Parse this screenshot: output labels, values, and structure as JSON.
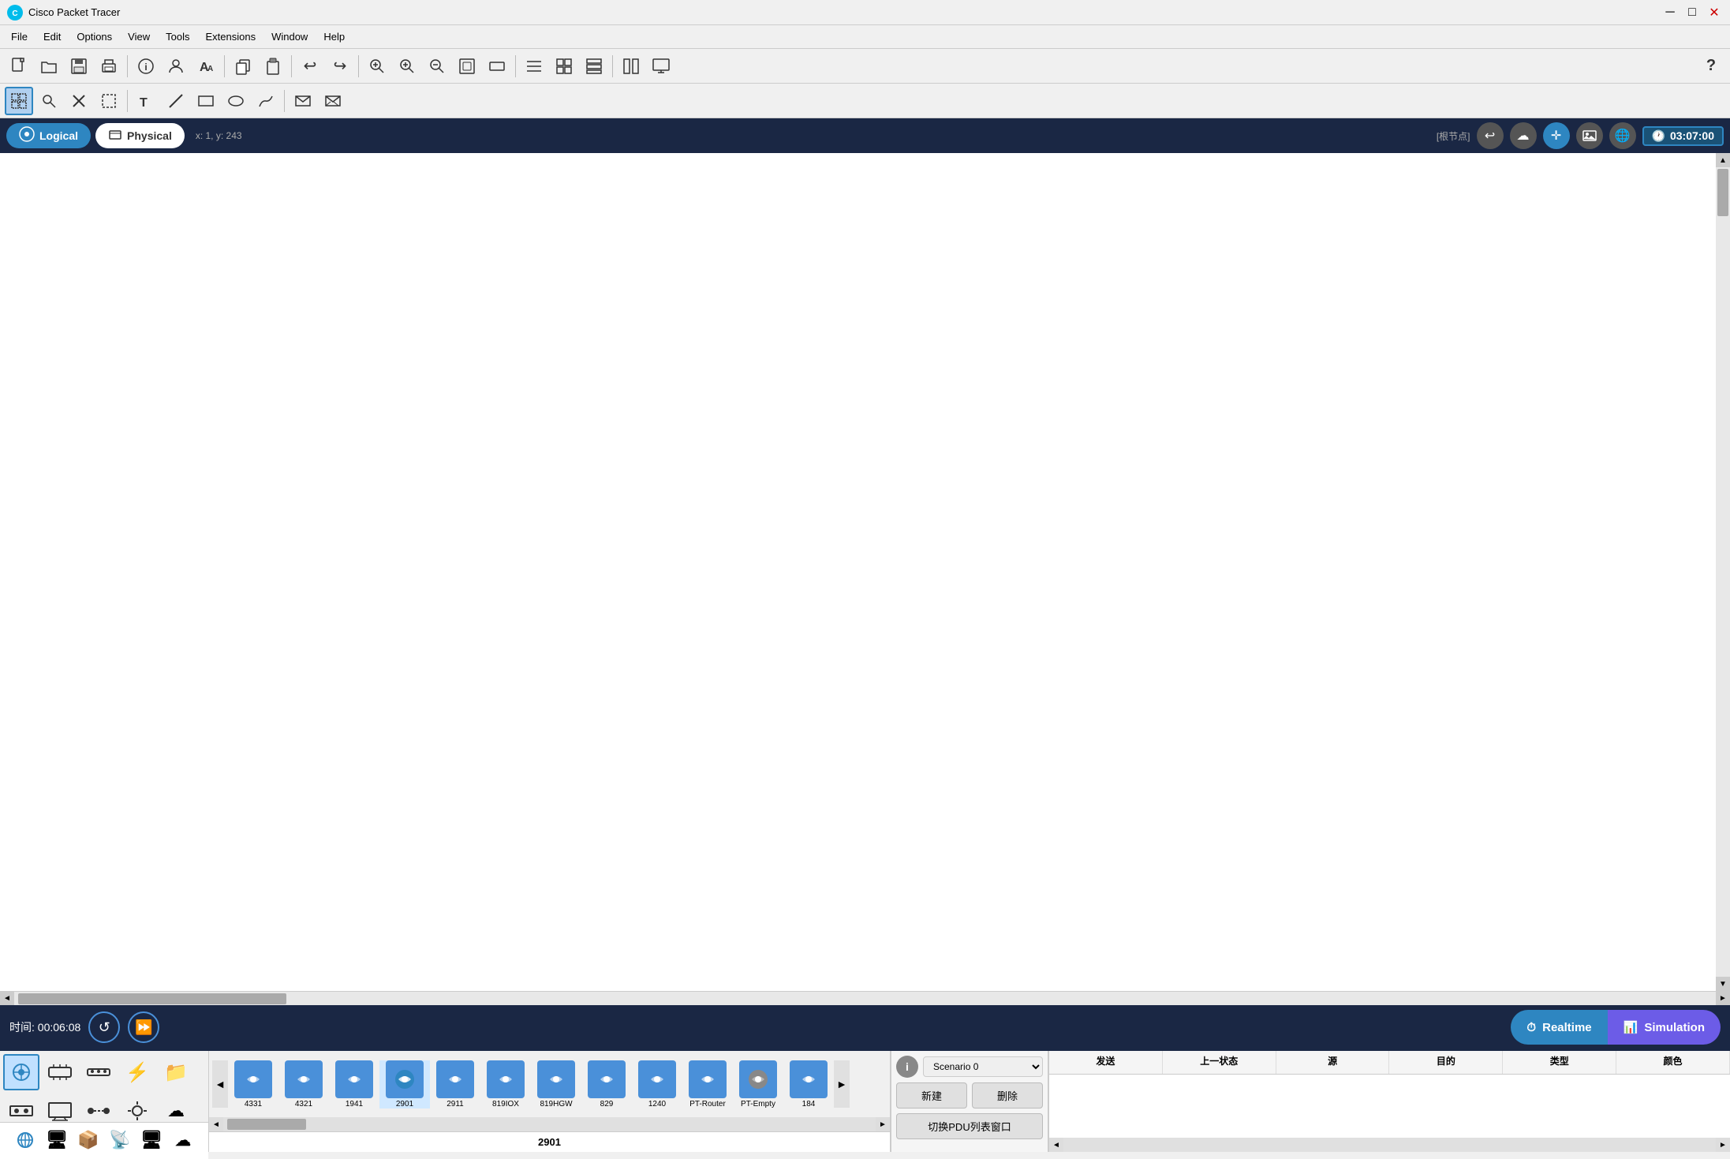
{
  "app": {
    "title": "Cisco Packet Tracer",
    "logo": "🌐"
  },
  "titlebar": {
    "title": "Cisco Packet Tracer",
    "minimize": "─",
    "maximize": "□",
    "close": "✕"
  },
  "menubar": {
    "items": [
      "File",
      "Edit",
      "Options",
      "View",
      "Tools",
      "Extensions",
      "Window",
      "Help"
    ]
  },
  "toolbar1": {
    "buttons": [
      {
        "name": "new",
        "icon": "📄",
        "label": "New"
      },
      {
        "name": "open",
        "icon": "📂",
        "label": "Open"
      },
      {
        "name": "save",
        "icon": "💾",
        "label": "Save"
      },
      {
        "name": "print",
        "icon": "🖨",
        "label": "Print"
      },
      {
        "name": "info",
        "icon": "ℹ",
        "label": "Activity Info"
      },
      {
        "name": "user",
        "icon": "👤",
        "label": "User Profile"
      },
      {
        "name": "font",
        "icon": "🔤",
        "label": "Font"
      },
      {
        "name": "copy",
        "icon": "📋",
        "label": "Copy"
      },
      {
        "name": "paste",
        "icon": "📃",
        "label": "Paste"
      },
      {
        "name": "undo",
        "icon": "↩",
        "label": "Undo"
      },
      {
        "name": "redo",
        "icon": "↪",
        "label": "Redo"
      },
      {
        "name": "zoom-in-center",
        "icon": "🔍",
        "label": "Zoom to Center"
      },
      {
        "name": "zoom-in",
        "icon": "🔎",
        "label": "Zoom In"
      },
      {
        "name": "zoom-out",
        "icon": "🔍",
        "label": "Zoom Out"
      },
      {
        "name": "rect-zoom",
        "icon": "⬜",
        "label": "Zoom to Fit"
      },
      {
        "name": "custom-zoom",
        "icon": "▭",
        "label": "Custom Zoom"
      },
      {
        "name": "list",
        "icon": "☰",
        "label": "List"
      },
      {
        "name": "grid",
        "icon": "⊞",
        "label": "Grid"
      },
      {
        "name": "layers",
        "icon": "⊟",
        "label": "Layers"
      },
      {
        "name": "help",
        "icon": "?",
        "label": "Help"
      }
    ]
  },
  "toolbar2": {
    "buttons": [
      {
        "name": "select",
        "icon": "⬚",
        "label": "Select",
        "active": true
      },
      {
        "name": "zoom-tool",
        "icon": "🔍",
        "label": "Zoom"
      },
      {
        "name": "cancel",
        "icon": "✖",
        "label": "Cancel"
      },
      {
        "name": "rect-select",
        "icon": "⬜",
        "label": "Rectangle Select"
      },
      {
        "name": "text",
        "icon": "📝",
        "label": "Add Text"
      },
      {
        "name": "line",
        "icon": "╱",
        "label": "Draw Line"
      },
      {
        "name": "rect-shape",
        "icon": "▭",
        "label": "Draw Rectangle"
      },
      {
        "name": "ellipse",
        "icon": "⬭",
        "label": "Draw Ellipse"
      },
      {
        "name": "freehand",
        "icon": "✏",
        "label": "Freehand"
      },
      {
        "name": "email-closed",
        "icon": "✉",
        "label": "Add Simple PDU"
      },
      {
        "name": "email-open",
        "icon": "📨",
        "label": "Add Complex PDU"
      }
    ]
  },
  "workspace": {
    "logical_tab": "Logical",
    "physical_tab": "Physical",
    "coords": "x: 1, y: 243",
    "root_node": "[根节点]",
    "time": "03:07:00"
  },
  "workspace_right_icons": [
    {
      "name": "back",
      "icon": "↩"
    },
    {
      "name": "cloud",
      "icon": "☁"
    },
    {
      "name": "move",
      "icon": "✛"
    },
    {
      "name": "image",
      "icon": "🖼"
    },
    {
      "name": "network",
      "icon": "🌐"
    }
  ],
  "timebar": {
    "time_label": "时间: 00:06:08",
    "reset_icon": "↺",
    "play_icon": "⏩",
    "realtime_label": "Realtime",
    "simulation_label": "Simulation",
    "realtime_icon": "⏱",
    "simulation_icon": "📊"
  },
  "device_categories": [
    {
      "name": "routers",
      "icon": "🔀",
      "label": "Routers",
      "active": true
    },
    {
      "name": "switches",
      "icon": "🖥",
      "label": "Switches"
    },
    {
      "name": "hubs",
      "icon": "📦",
      "label": "Hubs"
    },
    {
      "name": "lightning",
      "icon": "⚡",
      "label": "Wireless Devices"
    },
    {
      "name": "security",
      "icon": "📁",
      "label": "Security"
    },
    {
      "name": "wan",
      "icon": "🌐",
      "label": "WAN Emulation"
    },
    {
      "name": "end-devices",
      "icon": "💻",
      "label": "End Devices"
    },
    {
      "name": "connections",
      "icon": "🔗",
      "label": "Connections"
    },
    {
      "name": "misc",
      "icon": "📡",
      "label": "Custom Made Devices"
    },
    {
      "name": "multiuser",
      "icon": "☁",
      "label": "Multiuser Connection"
    }
  ],
  "device_category_label": "2901",
  "devices": [
    {
      "name": "4331",
      "label": "4331"
    },
    {
      "name": "4321",
      "label": "4321"
    },
    {
      "name": "1941",
      "label": "1941"
    },
    {
      "name": "2901",
      "label": "2901"
    },
    {
      "name": "2911",
      "label": "2911"
    },
    {
      "name": "819IOX",
      "label": "819IOX"
    },
    {
      "name": "819HGW",
      "label": "819HGW"
    },
    {
      "name": "829",
      "label": "829"
    },
    {
      "name": "1240",
      "label": "1240"
    },
    {
      "name": "PT-Router",
      "label": "PT-Router"
    },
    {
      "name": "PT-Empty",
      "label": "PT-Empty"
    },
    {
      "name": "184",
      "label": "184"
    }
  ],
  "right_panel": {
    "scenario_label": "Scenario 0",
    "new_btn": "新建",
    "delete_btn": "删除",
    "pdu_btn": "切换PDU列表窗口",
    "info_icon": "i"
  },
  "pdu_columns": {
    "send": "发送",
    "last_status": "上一状态",
    "source": "源",
    "destination": "目的",
    "type": "类型",
    "color": "颜色"
  }
}
